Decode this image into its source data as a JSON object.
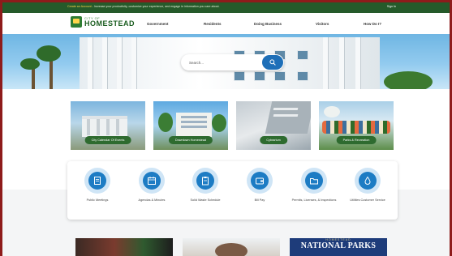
{
  "topbar": {
    "highlight": "Create an Account",
    "message": " - Increase your productivity, customize your experience, and engage in information you care about.",
    "signin": "Sign In"
  },
  "logo": {
    "small": "CITY OF",
    "big": "HOMESTEAD"
  },
  "nav": [
    "Government",
    "Residents",
    "Doing Business",
    "Visitors",
    "How Do I?"
  ],
  "search": {
    "placeholder": "Search..."
  },
  "cards": [
    {
      "label": "City Calendar Of Events"
    },
    {
      "label": "Downtown Homestead"
    },
    {
      "label": "Cybrarium"
    },
    {
      "label": "Parks & Recreation"
    }
  ],
  "services": [
    {
      "label": "Public Meetings",
      "icon": "document-icon"
    },
    {
      "label": "Agendas & Minutes",
      "icon": "calendar-icon"
    },
    {
      "label": "Solid Waste Schedule",
      "icon": "clipboard-icon"
    },
    {
      "label": "Bill Pay",
      "icon": "wallet-icon"
    },
    {
      "label": "Permits, Licenses, & Inspections",
      "icon": "folder-icon"
    },
    {
      "label": "Utilities Customer Service",
      "icon": "water-drop-icon"
    }
  ],
  "featured": {
    "np_small": "HOMESTEAD",
    "np_title": "NATIONAL PARKS"
  },
  "colors": {
    "brand_green": "#255a2a",
    "accent_blue": "#1d7cc4",
    "border": "#8e1b1b"
  }
}
